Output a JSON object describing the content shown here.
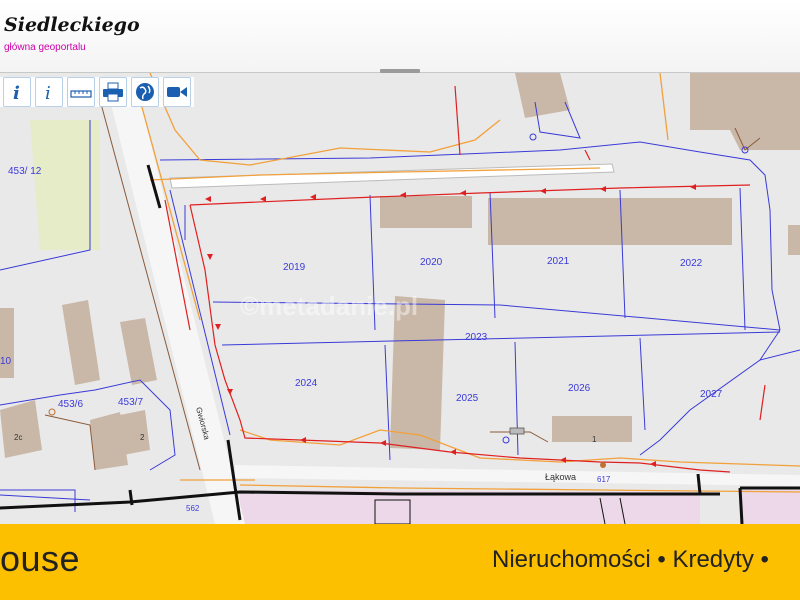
{
  "header": {
    "title": "Siedleckiego",
    "subtitle": "główna geoportalu"
  },
  "toolbar": {
    "buttons": [
      {
        "name": "info-pointer",
        "icon": "info-bold-icon"
      },
      {
        "name": "info",
        "icon": "info-icon"
      },
      {
        "name": "measure",
        "icon": "ruler-icon"
      },
      {
        "name": "print",
        "icon": "printer-icon"
      },
      {
        "name": "world",
        "icon": "globe-icon"
      },
      {
        "name": "video",
        "icon": "video-camera-icon"
      }
    ]
  },
  "map": {
    "parcel_labels": {
      "p453_12": "453/ 12",
      "p2019": "2019",
      "p2020": "2020",
      "p2021": "2021",
      "p2022": "2022",
      "p2023": "2023",
      "p2024": "2024",
      "p2025": "2025",
      "p2026": "2026",
      "p2027": "2027",
      "p453_6": "453/6",
      "p453_7": "453/7",
      "p10": "10",
      "p2c": "2c",
      "p2": "2",
      "p1": "1",
      "p562": "562",
      "p617": "617"
    },
    "street_labels": {
      "lakowa": "Łąkowa",
      "side": "Gwiorska"
    },
    "watermark": "©metadanie.pl",
    "colors": {
      "background": "#e9e9e9",
      "building": "#c9b8a8",
      "parcel_line": "#3a3ad8",
      "red_network": "#e02020",
      "orange_line": "#f2a03a",
      "green_area": "#e6ecc8",
      "pink_area": "#ecd8e8",
      "road": "#f4f4f4"
    }
  },
  "footer": {
    "brand": "ouse",
    "tagline": "Nieruchomości • Kredyty •"
  }
}
